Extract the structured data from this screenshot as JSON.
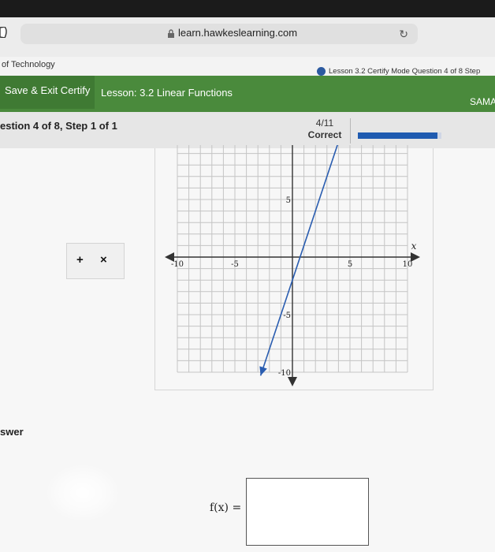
{
  "browser": {
    "url": "learn.hawkeslearning.com"
  },
  "tabs": {
    "left_label": "of Technology",
    "right_label": "Lesson 3.2 Certify Mode Question 4 of 8 Step"
  },
  "header": {
    "save_exit": "Save & Exit Certify",
    "lesson": "Lesson: 3.2 Linear Functions",
    "user": "SAMA"
  },
  "question": {
    "step_text": "estion 4 of 8, Step 1 of 1",
    "progress_count": "4/11",
    "progress_status": "Correct",
    "progress_fraction": 0.95
  },
  "tools": {
    "add": "+",
    "remove": "×"
  },
  "graph": {
    "x_label": "x",
    "x_ticks": [
      "-10",
      "-5",
      "5",
      "10"
    ],
    "y_ticks": [
      "5",
      "-5",
      "-10"
    ],
    "line_points": [
      [
        0,
        -2
      ],
      [
        1,
        1
      ]
    ]
  },
  "answer": {
    "label": "swer",
    "fx_label": "f(x) =",
    "value": ""
  },
  "colors": {
    "header_green": "#4a8a3c",
    "progress_blue": "#1f5bb0",
    "line_blue": "#2a5db0"
  }
}
